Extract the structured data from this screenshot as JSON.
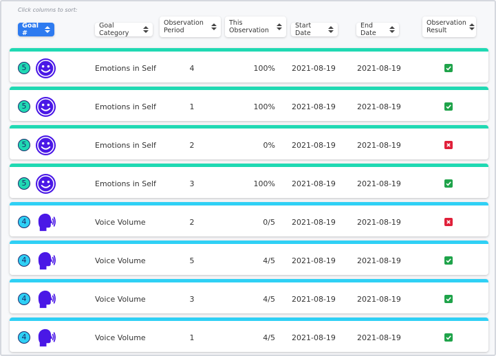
{
  "hint": "Click columns to sort:",
  "sort_buttons": [
    {
      "label": "Goal #",
      "active": true
    },
    {
      "label": "Goal Category",
      "active": false
    },
    {
      "label": "Observation Period",
      "active": false
    },
    {
      "label": "This Observation",
      "active": false
    },
    {
      "label": "Start Date",
      "active": false
    },
    {
      "label": "End Date",
      "active": false
    },
    {
      "label": "Observation Result",
      "active": false
    }
  ],
  "colors": {
    "emotions_bar": "#20d9b3",
    "voice_bar": "#2fd0f5",
    "icon_purple": "#4a18e6",
    "pass": "#1fa34a",
    "fail": "#e0203a"
  },
  "rows": [
    {
      "goal": "5",
      "icon": "smiley-icon",
      "category": "Emotions in Self",
      "period": "4",
      "observation": "100%",
      "start": "2021-08-19",
      "end": "2021-08-19",
      "result": "pass"
    },
    {
      "goal": "5",
      "icon": "smiley-icon",
      "category": "Emotions in Self",
      "period": "1",
      "observation": "100%",
      "start": "2021-08-19",
      "end": "2021-08-19",
      "result": "pass"
    },
    {
      "goal": "5",
      "icon": "smiley-icon",
      "category": "Emotions in Self",
      "period": "2",
      "observation": "0%",
      "start": "2021-08-19",
      "end": "2021-08-19",
      "result": "fail"
    },
    {
      "goal": "5",
      "icon": "smiley-icon",
      "category": "Emotions in Self",
      "period": "3",
      "observation": "100%",
      "start": "2021-08-19",
      "end": "2021-08-19",
      "result": "pass"
    },
    {
      "goal": "4",
      "icon": "speaking-head-icon",
      "category": "Voice Volume",
      "period": "2",
      "observation": "0/5",
      "start": "2021-08-19",
      "end": "2021-08-19",
      "result": "fail"
    },
    {
      "goal": "4",
      "icon": "speaking-head-icon",
      "category": "Voice Volume",
      "period": "5",
      "observation": "4/5",
      "start": "2021-08-19",
      "end": "2021-08-19",
      "result": "pass"
    },
    {
      "goal": "4",
      "icon": "speaking-head-icon",
      "category": "Voice Volume",
      "period": "3",
      "observation": "4/5",
      "start": "2021-08-19",
      "end": "2021-08-19",
      "result": "pass"
    },
    {
      "goal": "4",
      "icon": "speaking-head-icon",
      "category": "Voice Volume",
      "period": "1",
      "observation": "4/5",
      "start": "2021-08-19",
      "end": "2021-08-19",
      "result": "pass"
    }
  ]
}
